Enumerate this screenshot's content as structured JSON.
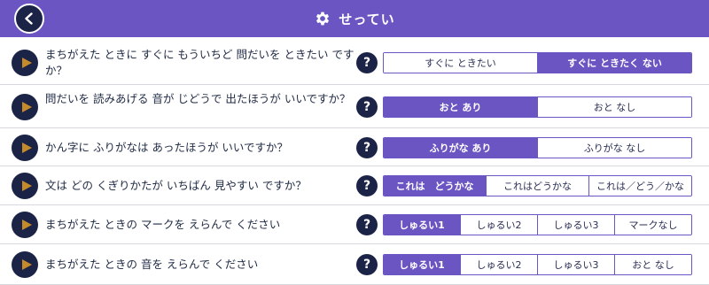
{
  "header": {
    "title": "せってい",
    "back_icon": "chevron-left-icon",
    "settings_icon": "gear-icon",
    "bg_color": "#6a55c2"
  },
  "colors": {
    "accent": "#6a55c2",
    "dark": "#1b2447"
  },
  "help_label": "?",
  "rows": [
    {
      "question": "まちがえた ときに すぐに もういちど 問だいを ときたい です か？",
      "options": [
        "すぐに ときたい",
        "すぐに ときたく ない"
      ],
      "selected": 1
    },
    {
      "question": "問だいを 読みあげる 音が じどうで 出たほうが いいですか？",
      "options": [
        "おと あり",
        "おと なし"
      ],
      "selected": 0
    },
    {
      "question": "かん字に ふりがなは あったほうが いいですか？",
      "options": [
        "ふりがな あり",
        "ふりがな なし"
      ],
      "selected": 0
    },
    {
      "question": "文は どの くぎりかたが いちばん 見やすい ですか？",
      "options": [
        "これは　どうかな",
        "これはどうかな",
        "これは／どう／かな"
      ],
      "selected": 0
    },
    {
      "question": "まちがえた ときの マークを えらんで ください",
      "options": [
        "しゅるい1",
        "しゅるい2",
        "しゅるい3",
        "マークなし"
      ],
      "selected": 0
    },
    {
      "question": "まちがえた ときの 音を えらんで ください",
      "options": [
        "しゅるい1",
        "しゅるい2",
        "しゅるい3",
        "おと なし"
      ],
      "selected": 0
    }
  ]
}
